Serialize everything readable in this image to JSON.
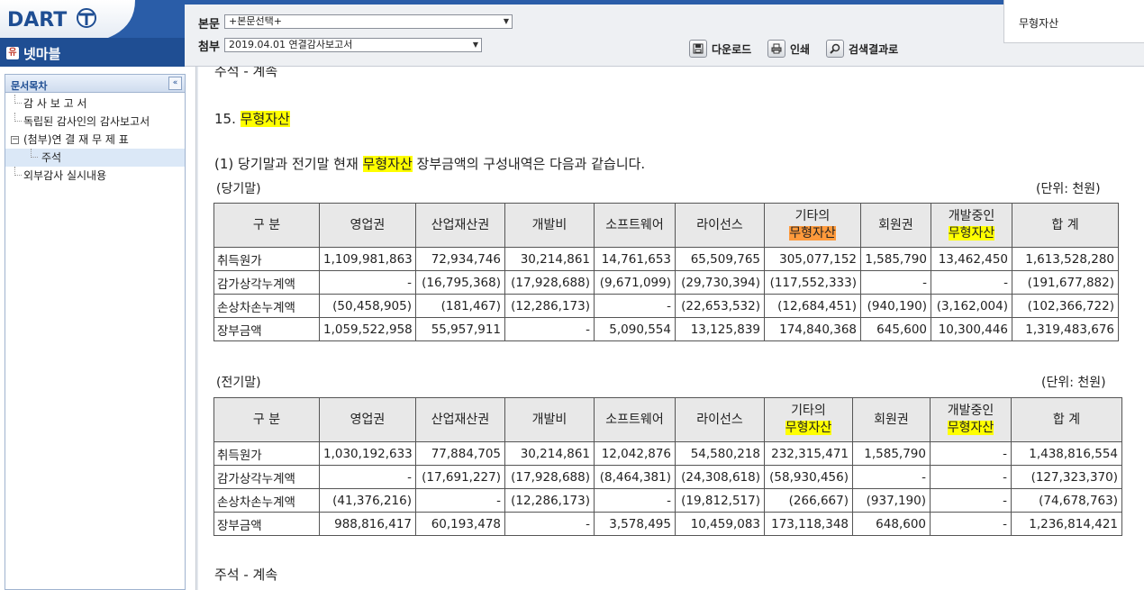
{
  "header": {
    "logo_text": "DART",
    "company": "넷마블",
    "company_badge": "유",
    "body_label": "본문",
    "body_select": "+본문선택+",
    "attach_label": "첨부",
    "attach_select": "2019.04.01  연결감사보고서",
    "download_label": "다운로드",
    "print_label": "인쇄",
    "search_results_label": "검색결과로",
    "search_popup_text": "무형자산",
    "brand_color": "#1f4e93"
  },
  "sidebar": {
    "title": "문서목차",
    "collapse_glyph": "«",
    "items": [
      {
        "label": "감 사 보 고 서"
      },
      {
        "label": "독립된 감사인의 감사보고서"
      },
      {
        "label": "(첨부)연 결 재 무 제 표"
      },
      {
        "label": "주석"
      },
      {
        "label": "외부감사 실시내용"
      }
    ]
  },
  "content": {
    "top_partial": "주석 - 계속",
    "section_num": "15.",
    "section_title": "무형자산",
    "intro_pre": "(1) 당기말과 전기말 현재",
    "intro_hl": "무형자산",
    "intro_post": "장부금액의 구성내역은 다음과 같습니다.",
    "footer": "주석 - 계속",
    "tables": [
      {
        "label": "(당기말)",
        "unit": "(단위: 천원)",
        "headers": {
          "c0": "구  분",
          "c1": "영업권",
          "c2": "산업재산권",
          "c3": "개발비",
          "c4": "소프트웨어",
          "c5": "라이선스",
          "c6_top": "기타의",
          "c6_hl": "무형자산",
          "c7": "회원권",
          "c8_top": "개발중인",
          "c8_hl": "무형자산",
          "c9": "합  계"
        },
        "rows": [
          [
            "취득원가",
            "1,109,981,863",
            "72,934,746",
            "30,214,861",
            "14,761,653",
            "65,509,765",
            "305,077,152",
            "1,585,790",
            "13,462,450",
            "1,613,528,280"
          ],
          [
            "감가상각누계액",
            "-",
            "(16,795,368)",
            "(17,928,688)",
            "(9,671,099)",
            "(29,730,394)",
            "(117,552,333)",
            "-",
            "-",
            "(191,677,882)"
          ],
          [
            "손상차손누계액",
            "(50,458,905)",
            "(181,467)",
            "(12,286,173)",
            "-",
            "(22,653,532)",
            "(12,684,451)",
            "(940,190)",
            "(3,162,004)",
            "(102,366,722)"
          ],
          [
            "장부금액",
            "1,059,522,958",
            "55,957,911",
            "-",
            "5,090,554",
            "13,125,839",
            "174,840,368",
            "645,600",
            "10,300,446",
            "1,319,483,676"
          ]
        ]
      },
      {
        "label": "(전기말)",
        "unit": "(단위: 천원)",
        "headers": {
          "c0": "구  분",
          "c1": "영업권",
          "c2": "산업재산권",
          "c3": "개발비",
          "c4": "소프트웨어",
          "c5": "라이선스",
          "c6_top": "기타의",
          "c6_hl": "무형자산",
          "c7": "회원권",
          "c8_top": "개발중인",
          "c8_hl": "무형자산",
          "c9": "합  계"
        },
        "rows": [
          [
            "취득원가",
            "1,030,192,633",
            "77,884,705",
            "30,214,861",
            "12,042,876",
            "54,580,218",
            "232,315,471",
            "1,585,790",
            "-",
            "1,438,816,554"
          ],
          [
            "감가상각누계액",
            "-",
            "(17,691,227)",
            "(17,928,688)",
            "(8,464,381)",
            "(24,308,618)",
            "(58,930,456)",
            "-",
            "-",
            "(127,323,370)"
          ],
          [
            "손상차손누계액",
            "(41,376,216)",
            "-",
            "(12,286,173)",
            "-",
            "(19,812,517)",
            "(266,667)",
            "(937,190)",
            "-",
            "(74,678,763)"
          ],
          [
            "장부금액",
            "988,816,417",
            "60,193,478",
            "-",
            "3,578,495",
            "10,459,083",
            "173,118,348",
            "648,600",
            "-",
            "1,236,814,421"
          ]
        ]
      }
    ]
  }
}
